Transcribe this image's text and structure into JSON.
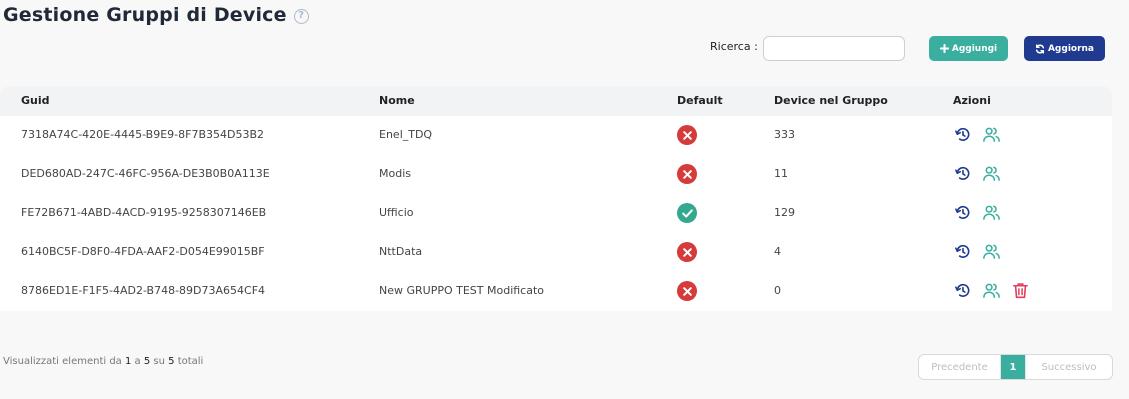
{
  "header": {
    "title": "Gestione Gruppi di Device",
    "help_icon": "question-circle-icon"
  },
  "toolbar": {
    "search_label": "Ricerca :",
    "search_value": "",
    "add_label": "Aggiungi",
    "refresh_label": "Aggiorna",
    "add_color": "#3aafa0",
    "refresh_color": "#1f3a8e"
  },
  "table": {
    "columns": [
      "Guid",
      "Nome",
      "Default",
      "Device nel Gruppo",
      "Azioni"
    ],
    "rows": [
      {
        "guid": "7318A74C-420E-4445-B9E9-8F7B354D53B2",
        "name": "Enel_TDQ",
        "default": false,
        "count": "333",
        "actions": [
          "history-icon",
          "users-icon"
        ]
      },
      {
        "guid": "DED680AD-247C-46FC-956A-DE3B0B0A113E",
        "name": "Modis",
        "default": false,
        "count": "11",
        "actions": [
          "history-icon",
          "users-icon"
        ]
      },
      {
        "guid": "FE72B671-4ABD-4ACD-9195-9258307146EB",
        "name": "Ufficio",
        "default": true,
        "count": "129",
        "actions": [
          "history-icon",
          "users-icon"
        ]
      },
      {
        "guid": "6140BC5F-D8F0-4FDA-AAF2-D054E99015BF",
        "name": "NttData",
        "default": false,
        "count": "4",
        "actions": [
          "history-icon",
          "users-icon"
        ]
      },
      {
        "guid": "8786ED1E-F1F5-4AD2-B748-89D73A654CF4",
        "name": "New GRUPPO TEST Modificato",
        "default": false,
        "count": "0",
        "actions": [
          "history-icon",
          "users-icon",
          "trash-icon"
        ]
      }
    ]
  },
  "footer": {
    "info_prefix": "Visualizzati elementi da ",
    "info_from": "1",
    "info_mid1": " a ",
    "info_to": "5",
    "info_mid2": " su ",
    "info_total": "5",
    "info_suffix": " totali"
  },
  "pagination": {
    "prev_label": "Precedente",
    "current_page": "1",
    "next_label": "Successivo"
  },
  "colors": {
    "false_status": "#d63b3b",
    "true_status": "#35a98f",
    "history_icon": "#1f3a8e",
    "users_icon": "#3aafa0",
    "trash_icon": "#e0405e"
  }
}
